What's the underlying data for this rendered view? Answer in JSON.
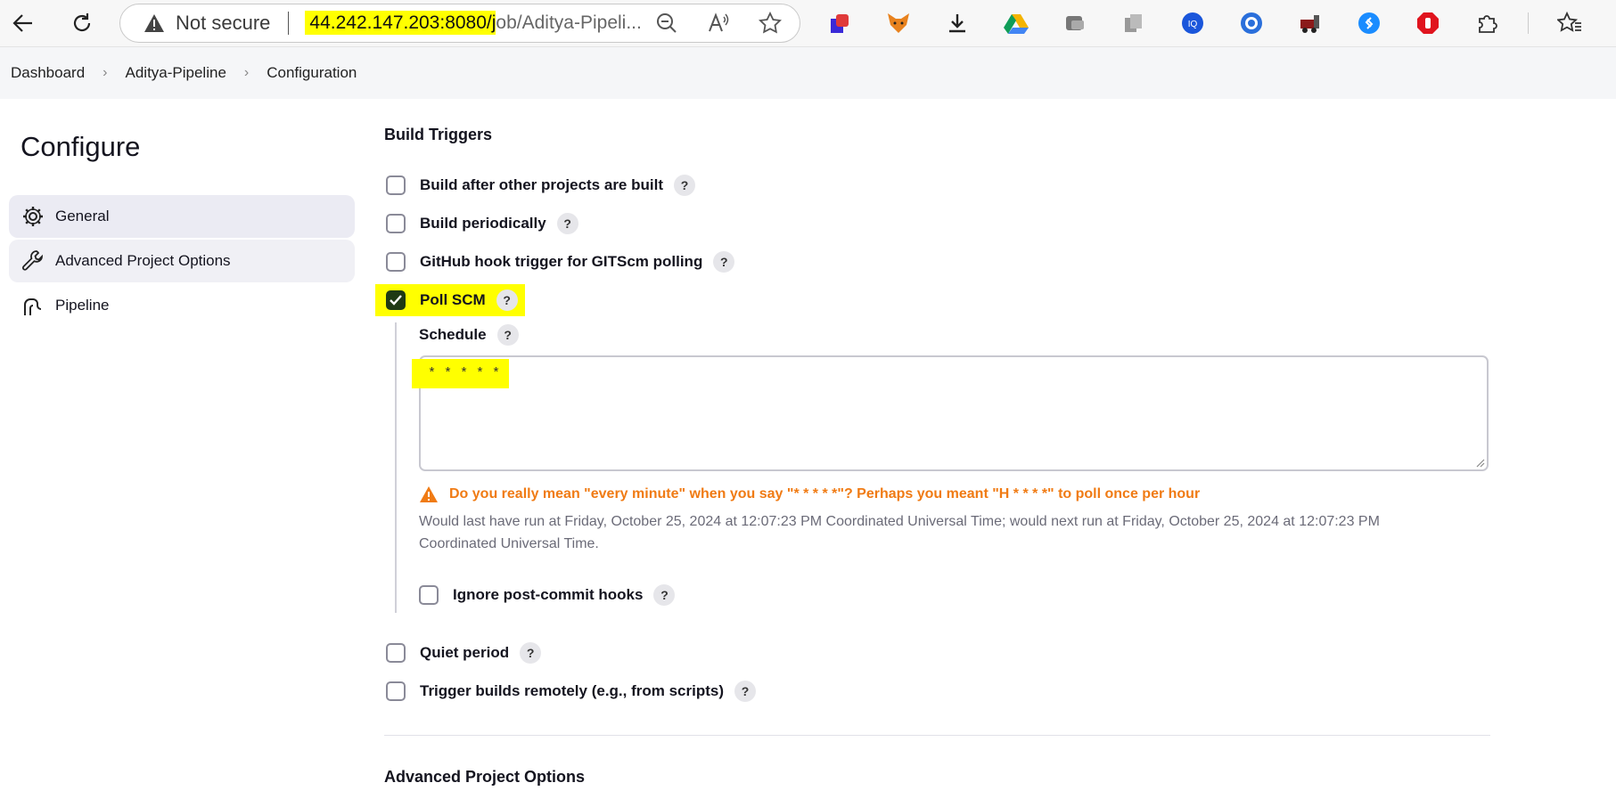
{
  "browser": {
    "not_secure": "Not secure",
    "url_highlighted": "44.242.147.203:8080/j",
    "url_rest": "ob/Aditya-Pipeli..."
  },
  "breadcrumb": [
    "Dashboard",
    "Aditya-Pipeline",
    "Configuration"
  ],
  "sidebar": {
    "title": "Configure",
    "items": [
      {
        "label": "General",
        "icon": "gear-icon"
      },
      {
        "label": "Advanced Project Options",
        "icon": "wrench-icon"
      },
      {
        "label": "Pipeline",
        "icon": "pipeline-icon"
      }
    ]
  },
  "main": {
    "section_title": "Build Triggers",
    "triggers": [
      {
        "label": "Build after other projects are built",
        "checked": false
      },
      {
        "label": "Build periodically",
        "checked": false
      },
      {
        "label": "GitHub hook trigger for GITScm polling",
        "checked": false
      },
      {
        "label": "Poll SCM",
        "checked": true
      }
    ],
    "schedule": {
      "label": "Schedule",
      "value": "* * * * *",
      "warning": "Do you really mean \"every minute\" when you say \"* * * * *\"? Perhaps you meant \"H * * * *\" to poll once per hour",
      "note": "Would last have run at Friday, October 25, 2024 at 12:07:23 PM Coordinated Universal Time; would next run at Friday, October 25, 2024 at 12:07:23 PM Coordinated Universal Time."
    },
    "ignore_hooks": {
      "label": "Ignore post-commit hooks",
      "checked": false
    },
    "more_triggers": [
      {
        "label": "Quiet period",
        "checked": false
      },
      {
        "label": "Trigger builds remotely (e.g., from scripts)",
        "checked": false
      }
    ],
    "next_section_title": "Advanced Project Options",
    "help_label": "?"
  },
  "colors": {
    "accent_check": "#1f3a14",
    "warning": "#f07b14",
    "highlight": "#ffff00"
  }
}
